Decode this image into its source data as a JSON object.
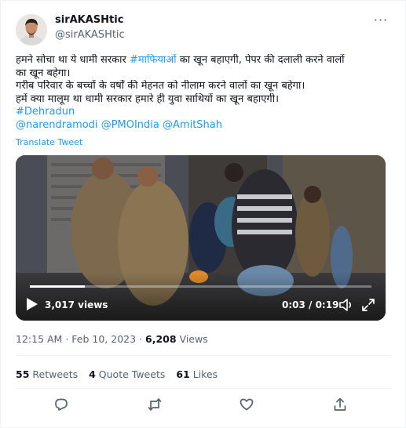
{
  "author": {
    "display_name": "sirAKASHtic",
    "handle": "@sirAKASHtic"
  },
  "tweet": {
    "line1_pre": "हमने सोचा था ये धामी सरकार ",
    "line1_hashtag": "#माफियाओं",
    "line1_post": " का खून बहाएगी, पेपर की दलाली करने वालों",
    "line2": "का खून बहेगा।",
    "line3": "गरीब परिवार के बच्चों के वर्षों की मेहनत को नीलाम करने वालों का खून बहेगा।",
    "line4": "हमें क्या मालूम था धामी सरकार हमारे ही युवा साथियों का खून बहाएगी।",
    "hashtag": "#Dehradun",
    "mention1": "@narendramodi",
    "mention2": "@PMOIndia",
    "mention3": "@AmitShah",
    "translate": "Translate Tweet"
  },
  "video": {
    "views": "3,017 views",
    "time": "0:03 / 0:19",
    "progress": 0.16
  },
  "meta": {
    "time": "12:15 AM",
    "sep": "·",
    "date": "Feb 10, 2023",
    "views_count": "6,208",
    "views_label": "Views"
  },
  "stats": {
    "retweets_count": "55",
    "retweets_label": "Retweets",
    "quotes_count": "4",
    "quotes_label": "Quote Tweets",
    "likes_count": "61",
    "likes_label": "Likes"
  },
  "icons": {
    "more": "more-icon",
    "reply": "reply-icon",
    "retweet": "retweet-icon",
    "like": "heart-icon",
    "share": "share-icon",
    "play": "play-icon",
    "volume": "volume-icon",
    "fullscreen": "fullscreen-icon"
  },
  "colors": {
    "accent": "#1d9bf0",
    "text": "#0f1419",
    "secondary": "#536471"
  }
}
